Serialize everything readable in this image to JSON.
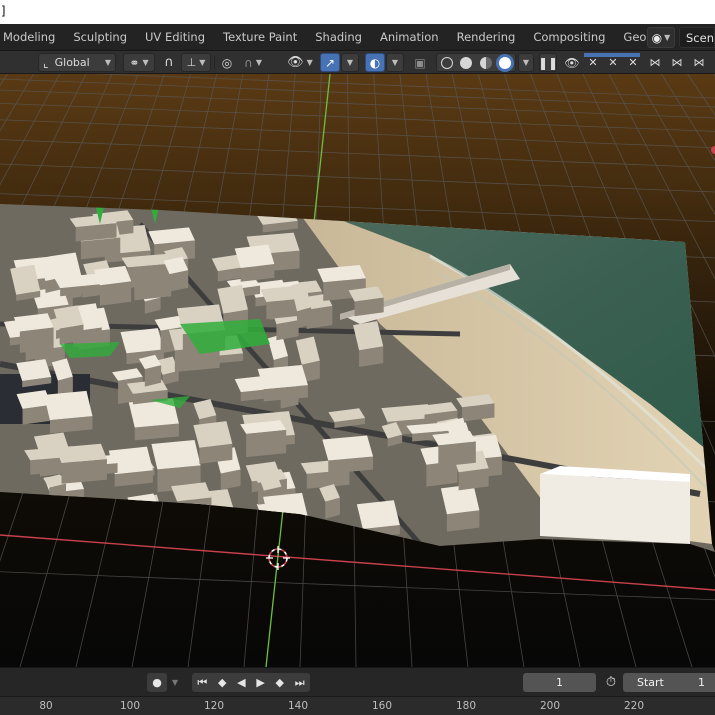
{
  "window": {
    "title_fragment": "]"
  },
  "workspace_tabs": [
    "Modeling",
    "Sculpting",
    "UV Editing",
    "Texture Paint",
    "Shading",
    "Animation",
    "Rendering",
    "Compositing",
    "Geometry Nod"
  ],
  "scene": {
    "icon": "scene-icon",
    "name": "Scene"
  },
  "toolbar": {
    "orientation_icon": "transform-orientation-icon",
    "orientation": "Global",
    "pivot_icon": "pivot-point-icon",
    "snap_icon": "snap-magnet-icon",
    "snap_increment_icon": "snap-increment-icon",
    "proportional_icon": "proportional-edit-icon",
    "falloff_icon": "falloff-curve-icon",
    "visibility_icon": "object-visibility-icon",
    "gizmo_icon": "gizmo-icon",
    "overlay_icon": "overlay-icon",
    "xray_icon": "xray-icon",
    "shading_modes": [
      "wireframe",
      "solid",
      "material-preview",
      "rendered"
    ],
    "active_shading": "rendered",
    "pause_icon": "pause-icon",
    "eye_icon": "eye-icon"
  },
  "viewport": {
    "grid_color": "#5a5a5a",
    "x_axis_color": "#c8414b",
    "y_axis_color": "#6fbf3f",
    "horizon_color": "#8a5414",
    "scene_content": "3D city model with beach and ocean"
  },
  "timeline": {
    "current_frame": "1",
    "start_label": "Start",
    "start_value": "1"
  },
  "ruler": {
    "ticks": [
      "80",
      "100",
      "120",
      "140",
      "160",
      "180",
      "200",
      "220"
    ]
  }
}
